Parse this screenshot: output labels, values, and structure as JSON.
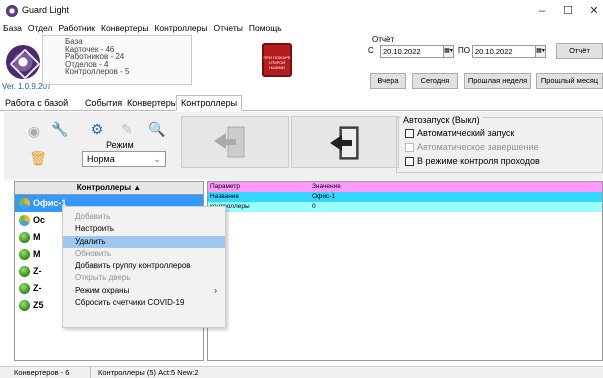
{
  "window": {
    "title": "Guard Light",
    "minimize": "–",
    "maximize": "☐",
    "close": "✕"
  },
  "menu": [
    "База",
    "Отдел",
    "Работник",
    "Конвертеры",
    "Контроллеры",
    "Отчеты",
    "Помощь"
  ],
  "header": {
    "version": "Ver. 1.0.9.207",
    "db_lines": [
      "База",
      "Карточек - 46",
      "Работников - 24",
      "Отделов - 4",
      "Контроллеров - 5"
    ],
    "alarm_text": "ПРИ ПОЖАРЕ ОТКРОЙ НАЖМИ"
  },
  "report": {
    "title": "Отчёт",
    "from_label": "С",
    "from_date": "20.10.2022",
    "to_label": "ПО",
    "to_date": "20.10.2022",
    "report_button": "Отчёт",
    "yesterday": "Вчера",
    "today": "Сегодня",
    "last_week": "Прошлая неделя",
    "last_month": "Прошлый месяц"
  },
  "tabs": [
    "Работа с базой",
    "События",
    "Конвертеры",
    "Контроллеры"
  ],
  "active_tab": 3,
  "toolbar": {
    "mode_label": "Режим",
    "mode_value": "Норма",
    "mode_arrow": "⌄"
  },
  "autostart": {
    "group_label": "Автозапуск (Выкл)",
    "auto_start": "Автоматический запуск",
    "auto_finish": "Автоматическое завершение",
    "access_mode": "В режиме контроля проходов"
  },
  "controllers": {
    "header": "Контроллеры ▲",
    "rows": [
      {
        "name": "Офис-1",
        "selected": true
      },
      {
        "name": "Ос"
      },
      {
        "name": "М"
      },
      {
        "name": "М"
      },
      {
        "name": "Z-"
      },
      {
        "name": "Z-"
      },
      {
        "name": "Z5"
      }
    ]
  },
  "params": {
    "headers": [
      "Параметр",
      "Значение"
    ],
    "rows": [
      [
        "Название",
        "Офис-1"
      ],
      [
        "контроллеры",
        "0"
      ]
    ],
    "colors": {
      "header": "#ff99ff",
      "row1": "#33d6ff",
      "row2": "#99ffff"
    }
  },
  "context_menu": [
    {
      "label": "Добавить",
      "disabled": true
    },
    {
      "label": "Настроить"
    },
    {
      "label": "Удалить",
      "highlighted": true
    },
    {
      "label": "Обновить",
      "disabled": true
    },
    {
      "label": "Добавить группу контроллеров"
    },
    {
      "label": "Открыть дверь",
      "disabled": true
    },
    {
      "label": "Режим охраны",
      "submenu": "›"
    },
    {
      "label": "Сбросить счетчики COVID-19"
    }
  ],
  "status": {
    "converters": "Конвертеров - 6",
    "controllers": "Контроллеры (5) Act:5 New:2"
  }
}
